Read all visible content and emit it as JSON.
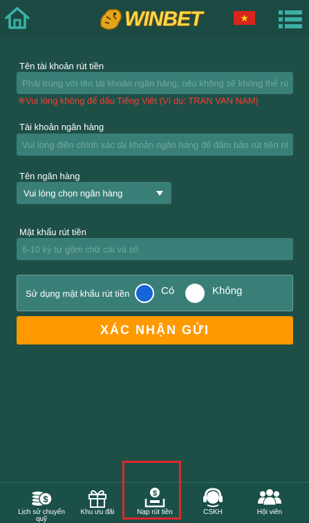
{
  "header": {
    "logo_text": "WINBET",
    "flag_star": "★"
  },
  "form": {
    "account_name_label": "Tên tài khoản rút tiền",
    "account_name_placeholder": "Phải trùng với tên tài khoản ngân hàng, nếu không sẽ không thể rút",
    "account_name_warning": "※Vui lòng không để dấu Tiếng Việt (Ví dụ: TRAN VAN NAM)",
    "bank_account_label": "Tài khoản ngân hàng",
    "bank_account_placeholder": "Vui lòng điền chính xác tài khoản ngân hàng để đảm bảo rút tiền nhanh",
    "bank_name_label": "Tên ngân hàng",
    "bank_select_value": "Vui lòng chọn ngân hàng",
    "password_label": "Mật khẩu rút tiền",
    "password_placeholder": "6-10 ký tự gồm chữ cái và số",
    "use_password_label": "Sử dụng mật khẩu rút tiền",
    "option_yes": "Có",
    "option_no": "Không",
    "selected_option": "Có",
    "submit_label": "XÁC NHẬN GỬI"
  },
  "bottom_nav": {
    "items": [
      {
        "label": "Lịch sử chuyển quỹ",
        "icon": "coins-icon"
      },
      {
        "label": "Khu ưu đãi",
        "icon": "gift-icon"
      },
      {
        "label": "Nạp rút tiền",
        "icon": "deposit-icon"
      },
      {
        "label": "CSKH",
        "icon": "headset-icon"
      },
      {
        "label": "Hội viên",
        "icon": "members-icon"
      }
    ]
  },
  "colors": {
    "background": "#1e4f47",
    "field": "#3a7f77",
    "accent": "#ff9900",
    "warning": "#ff3b30",
    "radio_selected": "#1565d8",
    "highlight": "#e3262c"
  }
}
